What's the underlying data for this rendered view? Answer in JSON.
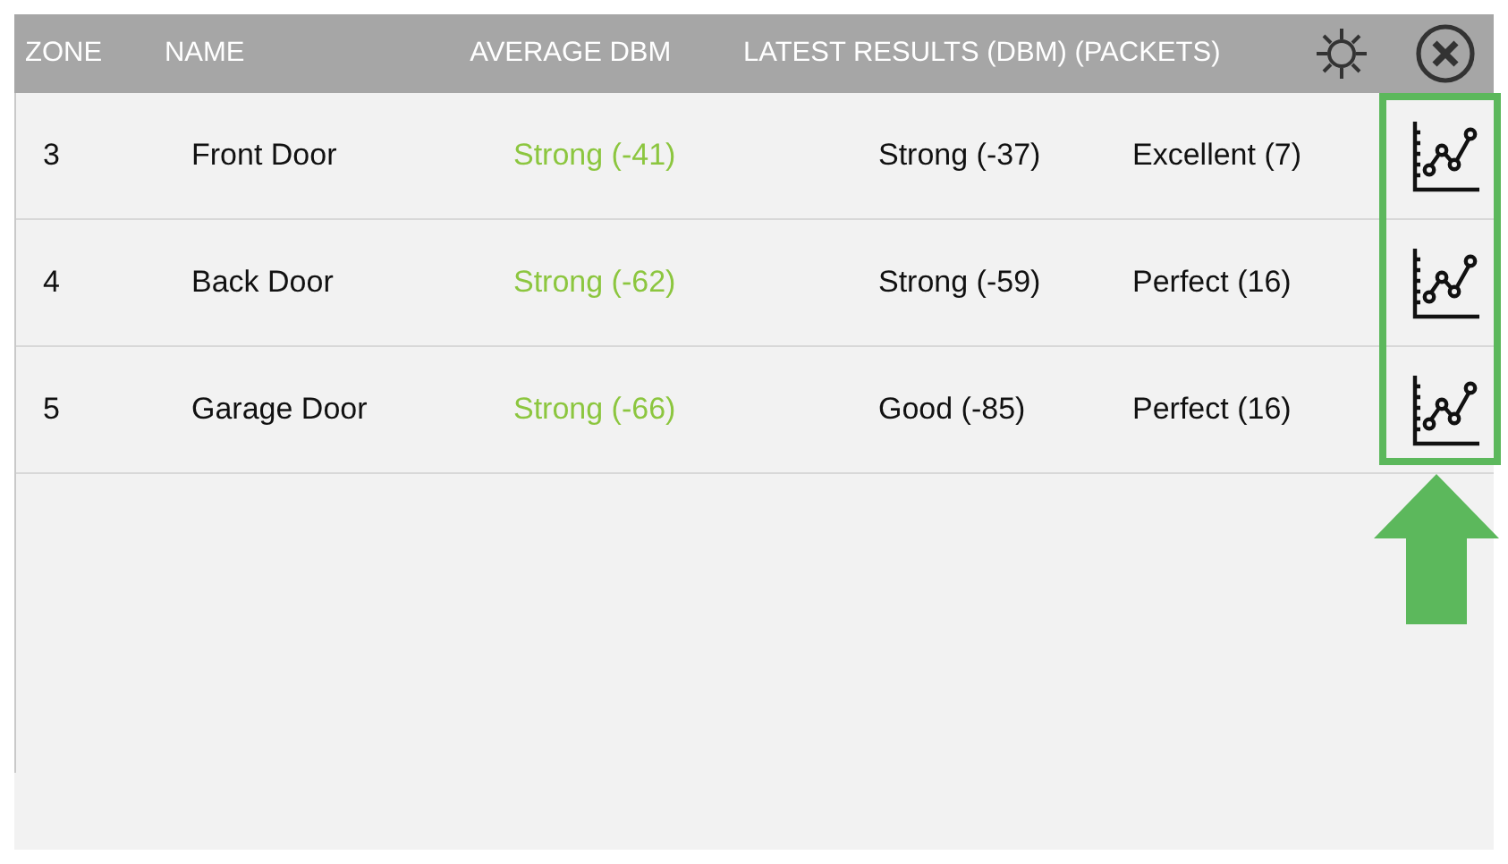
{
  "table": {
    "columns": [
      "ZONE",
      "NAME",
      "AVERAGE DBM",
      "LATEST RESULTS (DBM) (PACKETS)"
    ],
    "rows": [
      {
        "zone": "3",
        "name": "Front Door",
        "average": "Strong (-41)",
        "latest": "Strong (-37)",
        "packets": "Excellent (7)"
      },
      {
        "zone": "4",
        "name": "Back Door",
        "average": "Strong (-62)",
        "latest": "Strong (-59)",
        "packets": "Perfect (16)"
      },
      {
        "zone": "5",
        "name": "Garage Door",
        "average": "Strong (-66)",
        "latest": "Good (-85)",
        "packets": "Perfect (16)"
      }
    ]
  }
}
